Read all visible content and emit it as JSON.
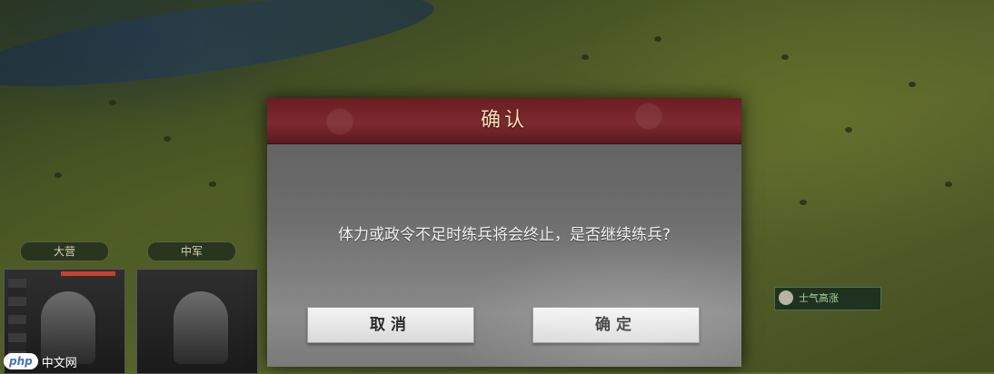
{
  "dialog": {
    "title": "确认",
    "message": "体力或政令不足时练兵将会终止，是否继续练兵?",
    "cancel_label": "取消",
    "confirm_label": "确定"
  },
  "background": {
    "tag_left": "大营",
    "tag_right": "中军",
    "right_chip_text": "士气高涨",
    "watermark": {
      "badge": "php",
      "text": "中文网"
    }
  },
  "colors": {
    "header_red": "#7d2a2e",
    "title_gold": "#f1dfb8",
    "button_face": "#f4f4f4"
  }
}
